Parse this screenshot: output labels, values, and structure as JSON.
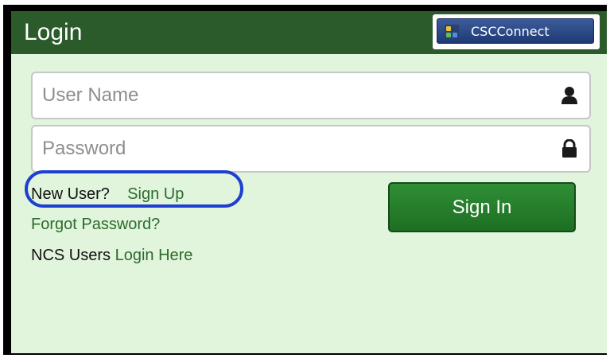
{
  "login_panel": {
    "title": "Login",
    "badge": {
      "label": "CSCConnect",
      "icon": "csc-logo-icon"
    },
    "username": {
      "placeholder": "User Name",
      "value": "",
      "icon": "user-icon"
    },
    "password": {
      "placeholder": "Password",
      "value": "",
      "icon": "lock-icon"
    },
    "new_user": {
      "prompt": "New User?",
      "link": "Sign Up"
    },
    "forgot_password": "Forgot Password?",
    "ncs": {
      "prefix": "NCS Users",
      "link": "Login Here"
    },
    "sign_in_label": "Sign In"
  },
  "colors": {
    "header": "#2b5b2b",
    "panel_background": "#e1f4dc",
    "link": "#2c6b2c",
    "button": "#1f7a27",
    "annotation_ring": "#1e3fd0"
  }
}
